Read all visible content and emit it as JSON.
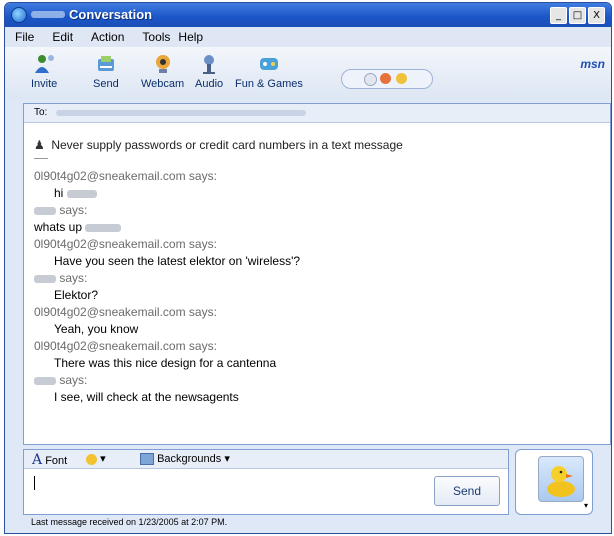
{
  "window": {
    "title": "Conversation",
    "controls": [
      "_",
      "□",
      "X"
    ]
  },
  "menu": [
    "File",
    "Edit",
    "Action",
    "Tools",
    "Help"
  ],
  "toolbar": {
    "invite": "Invite",
    "send": "Send",
    "webcam": "Webcam",
    "audio": "Audio",
    "games": "Fun & Games",
    "brand": "msn"
  },
  "to_label": "To:",
  "warning": "Never supply passwords or credit card numbers in a text message",
  "messages": [
    {
      "says": "0l90t4g02@sneakemail.com says:",
      "text": "hi"
    },
    {
      "says": "says:",
      "text": "whats up"
    },
    {
      "says": "0l90t4g02@sneakemail.com says:",
      "text": "Have you seen the latest elektor on 'wireless'?"
    },
    {
      "says": "says:",
      "text": "Elektor?"
    },
    {
      "says": "0l90t4g02@sneakemail.com says:",
      "text": "Yeah, you know"
    },
    {
      "says": "0l90t4g02@sneakemail.com says:",
      "text": "There was this nice design for a cantenna"
    },
    {
      "says": "says:",
      "text": "I see, will check at the newsagents"
    }
  ],
  "format_bar": {
    "font": "Font",
    "backgrounds": "Backgrounds"
  },
  "send_button": "Send",
  "status": "Last message received on 1/23/2005 at 2:07 PM.",
  "colors": {
    "title_blue": "#1b55c7",
    "panel_border": "#7e9ed4",
    "says_gray": "#6b6b6b"
  }
}
